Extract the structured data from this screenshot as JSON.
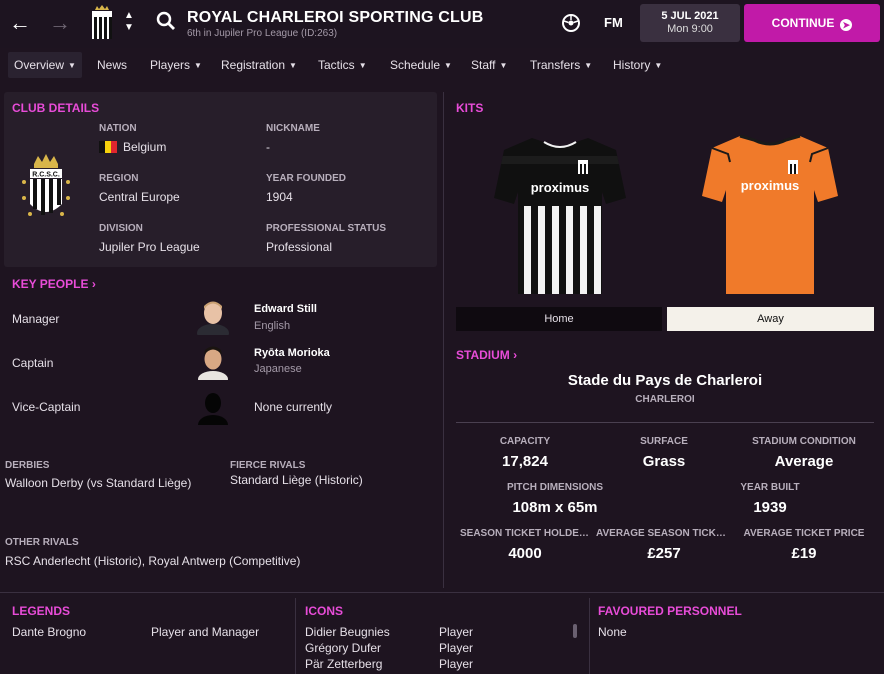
{
  "header": {
    "club_name": "ROYAL CHARLEROI SPORTING CLUB",
    "subtitle": "6th in Jupiler Pro League (ID:263)",
    "fm_logo": "FM",
    "date": "5 JUL 2021",
    "time": "Mon 9:00",
    "continue_label": "CONTINUE"
  },
  "menu": [
    {
      "label": "Overview",
      "caret": true
    },
    {
      "label": "News",
      "caret": false
    },
    {
      "label": "Players",
      "caret": true
    },
    {
      "label": "Registration",
      "caret": true
    },
    {
      "label": "Tactics",
      "caret": true
    },
    {
      "label": "Schedule",
      "caret": true
    },
    {
      "label": "Staff",
      "caret": true
    },
    {
      "label": "Transfers",
      "caret": true
    },
    {
      "label": "History",
      "caret": true
    }
  ],
  "club_details": {
    "title": "CLUB DETAILS",
    "badge_text": "R.C.S.C.",
    "nation_label": "NATION",
    "nation": "Belgium",
    "nickname_label": "NICKNAME",
    "nickname": "-",
    "region_label": "REGION",
    "region": "Central Europe",
    "founded_label": "YEAR FOUNDED",
    "founded": "1904",
    "division_label": "DIVISION",
    "division": "Jupiler Pro League",
    "status_label": "PROFESSIONAL STATUS",
    "status": "Professional"
  },
  "key_people": {
    "title": "KEY PEOPLE",
    "rows": [
      {
        "role": "Manager",
        "name": "Edward Still",
        "nationality": "English"
      },
      {
        "role": "Captain",
        "name": "Ryōta Morioka",
        "nationality": "Japanese"
      },
      {
        "role": "Vice-Captain",
        "name": "None currently",
        "nationality": ""
      }
    ]
  },
  "rivals": {
    "derbies_label": "DERBIES",
    "derbies": "Walloon Derby (vs Standard Liège)",
    "fierce_label": "FIERCE RIVALS",
    "fierce": "Standard Liège (Historic)",
    "other_label": "OTHER RIVALS",
    "other": "RSC Anderlecht (Historic), Royal Antwerp (Competitive)"
  },
  "kits": {
    "title": "KITS",
    "sponsor": "proximus",
    "tabs": [
      "Home",
      "Away"
    ],
    "selected": "Away"
  },
  "stadium": {
    "title": "STADIUM",
    "name": "Stade du Pays de Charleroi",
    "city": "CHARLEROI",
    "capacity_label": "CAPACITY",
    "capacity": "17,824",
    "surface_label": "SURFACE",
    "surface": "Grass",
    "condition_label": "STADIUM CONDITION",
    "condition": "Average",
    "pitch_label": "PITCH DIMENSIONS",
    "pitch": "108m x 65m",
    "built_label": "YEAR BUILT",
    "built": "1939",
    "season_holders_label": "SEASON TICKET HOLDERS",
    "season_holders": "4000",
    "avg_season_label": "AVERAGE SEASON TICKET...",
    "avg_season": "£257",
    "avg_ticket_label": "AVERAGE TICKET PRICE",
    "avg_ticket": "£19"
  },
  "legends": {
    "title": "LEGENDS",
    "rows": [
      {
        "name": "Dante Brogno",
        "role": "Player and Manager"
      }
    ]
  },
  "icons_list": {
    "title": "ICONS",
    "rows": [
      {
        "name": "Didier Beugnies",
        "role": "Player"
      },
      {
        "name": "Grégory Dufer",
        "role": "Player"
      },
      {
        "name": "Pär Zetterberg",
        "role": "Player"
      }
    ]
  },
  "favoured": {
    "title": "FAVOURED PERSONNEL",
    "value": "None"
  },
  "colors": {
    "accent": "#e84cd8",
    "continue": "#c11aa8",
    "background": "#1e1420",
    "home_kit": "#111111",
    "away_kit": "#f07a2a"
  }
}
